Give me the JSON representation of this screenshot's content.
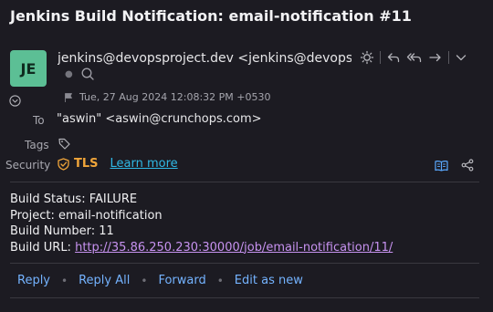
{
  "message": {
    "subject": "Jenkins Build Notification: email-notification #11",
    "avatar_initials": "JE",
    "avatar_color": "#5cbf95",
    "from": "jenkins@devopsproject.dev <jenkins@devopsproject",
    "date": "Tue, 27 Aug 2024 12:08:32 PM +0530",
    "to_label": "To",
    "to_value": "\"aswin\" <aswin@crunchops.com>",
    "tags_label": "Tags",
    "security_label": "Security",
    "security_value": "TLS",
    "learn_more": "Learn more"
  },
  "body": {
    "line1": "Build Status: FAILURE",
    "line2": "Project: email-notification",
    "line3": "Build Number: 11",
    "line4_label": "Build URL: ",
    "url": "http://35.86.250.230:30000/job/email-notification/11/"
  },
  "actions": {
    "reply": "Reply",
    "reply_all": "Reply All",
    "forward": "Forward",
    "edit_as_new": "Edit as new"
  },
  "icons": {
    "theme": "sun-icon",
    "reply": "reply-icon",
    "reply_all": "reply-all-icon",
    "forward": "forward-icon",
    "more": "chevron-down-icon",
    "search": "search-icon",
    "flag": "flag-icon",
    "expand": "chevron-circle-icon",
    "tag": "tag-icon",
    "security": "shield-icon",
    "book": "book-icon",
    "share": "share-icon"
  },
  "colors": {
    "background": "#1c1b22",
    "link": "#74b3ff",
    "url": "#c792f0",
    "tls": "#f0a53a",
    "learn_more": "#2fb9e6"
  }
}
